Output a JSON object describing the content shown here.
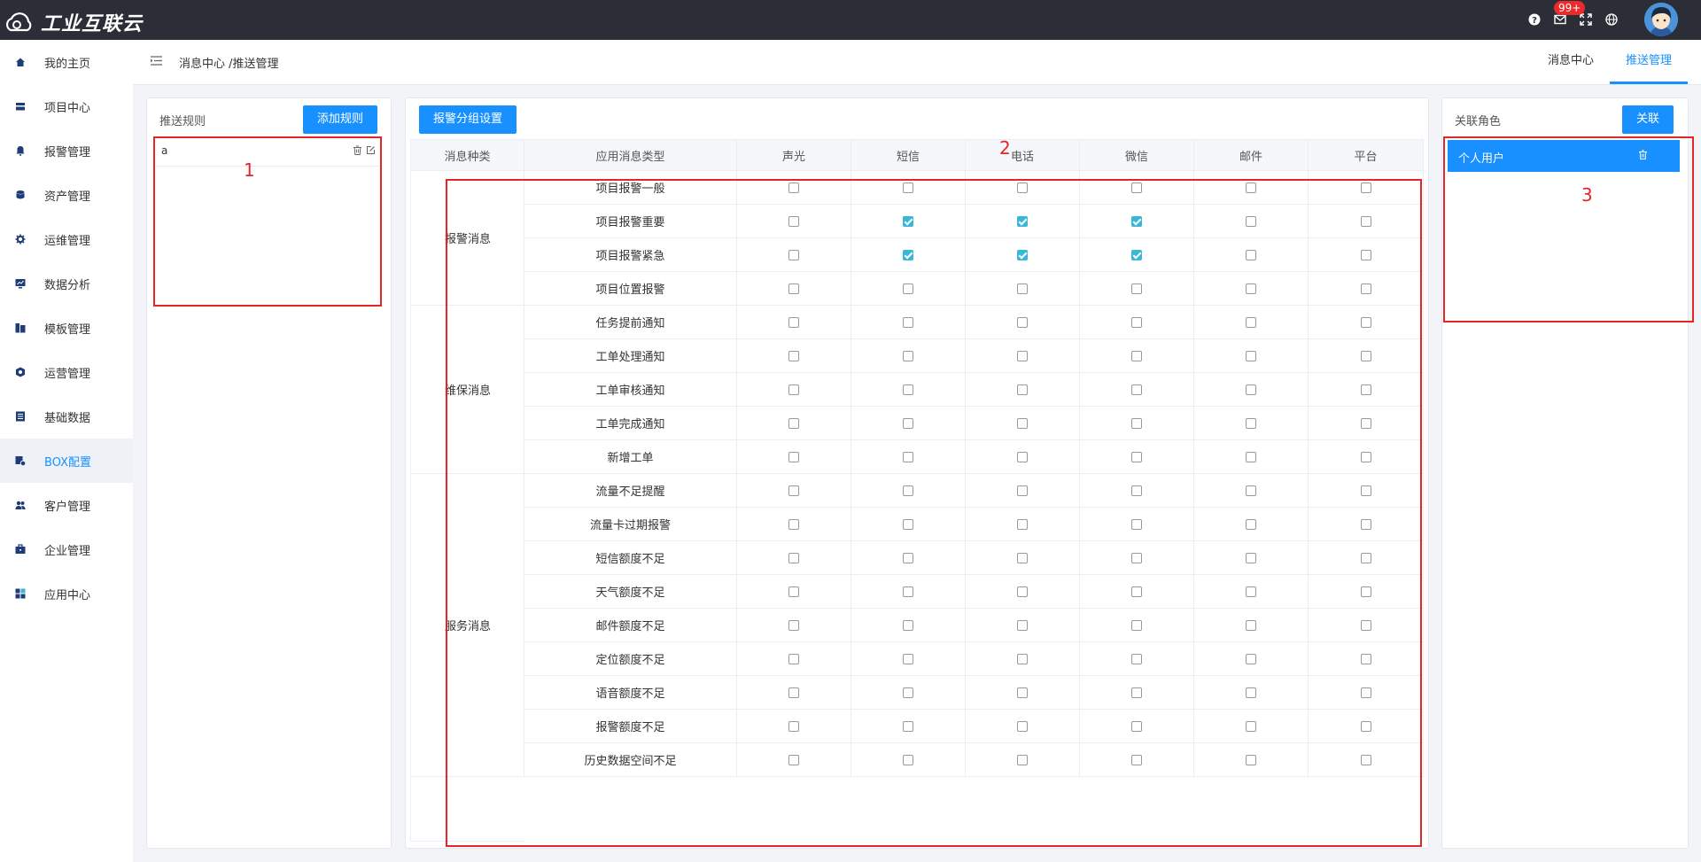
{
  "app": {
    "logo_text": "工业互联云",
    "badge": "99+"
  },
  "top_icons": [
    "help-icon",
    "mail-icon",
    "fullscreen-icon",
    "globe-icon"
  ],
  "sidebar": {
    "items": [
      {
        "label": "我的主页",
        "icon": "home-icon"
      },
      {
        "label": "项目中心",
        "icon": "project-icon"
      },
      {
        "label": "报警管理",
        "icon": "bell-icon"
      },
      {
        "label": "资产管理",
        "icon": "asset-icon"
      },
      {
        "label": "运维管理",
        "icon": "gear-icon"
      },
      {
        "label": "数据分析",
        "icon": "chart-icon"
      },
      {
        "label": "模板管理",
        "icon": "template-icon"
      },
      {
        "label": "运营管理",
        "icon": "operation-icon"
      },
      {
        "label": "基础数据",
        "icon": "database-icon"
      },
      {
        "label": "BOX配置",
        "icon": "box-config-icon",
        "active": true
      },
      {
        "label": "客户管理",
        "icon": "users-icon"
      },
      {
        "label": "企业管理",
        "icon": "briefcase-icon"
      },
      {
        "label": "应用中心",
        "icon": "apps-icon"
      }
    ]
  },
  "breadcrumb": "消息中心 /推送管理",
  "tabs": [
    {
      "label": "消息中心",
      "active": false
    },
    {
      "label": "推送管理",
      "active": true
    }
  ],
  "left_panel": {
    "title": "推送规则",
    "add_button": "添加规则",
    "rules": [
      {
        "name": "a"
      }
    ],
    "marker": "1"
  },
  "middle_panel": {
    "group_button": "报警分组设置",
    "marker": "2",
    "headers": [
      "消息种类",
      "应用消息类型",
      "声光",
      "短信",
      "电话",
      "微信",
      "邮件",
      "平台"
    ],
    "groups": [
      {
        "category": "报警消息",
        "rows": [
          {
            "type": "项目报警一般",
            "checks": [
              false,
              false,
              false,
              false,
              false,
              false
            ]
          },
          {
            "type": "项目报警重要",
            "checks": [
              false,
              true,
              true,
              true,
              false,
              false
            ]
          },
          {
            "type": "项目报警紧急",
            "checks": [
              false,
              true,
              true,
              true,
              false,
              false
            ]
          },
          {
            "type": "项目位置报警",
            "checks": [
              false,
              false,
              false,
              false,
              false,
              false
            ]
          }
        ]
      },
      {
        "category": "维保消息",
        "rows": [
          {
            "type": "任务提前通知",
            "checks": [
              false,
              false,
              false,
              false,
              false,
              false
            ]
          },
          {
            "type": "工单处理通知",
            "checks": [
              false,
              false,
              false,
              false,
              false,
              false
            ]
          },
          {
            "type": "工单审核通知",
            "checks": [
              false,
              false,
              false,
              false,
              false,
              false
            ]
          },
          {
            "type": "工单完成通知",
            "checks": [
              false,
              false,
              false,
              false,
              false,
              false
            ]
          },
          {
            "type": "新增工单",
            "checks": [
              false,
              false,
              false,
              false,
              false,
              false
            ]
          }
        ]
      },
      {
        "category": "服务消息",
        "rows": [
          {
            "type": "流量不足提醒",
            "checks": [
              false,
              false,
              false,
              false,
              false,
              false
            ]
          },
          {
            "type": "流量卡过期报警",
            "checks": [
              false,
              false,
              false,
              false,
              false,
              false
            ]
          },
          {
            "type": "短信额度不足",
            "checks": [
              false,
              false,
              false,
              false,
              false,
              false
            ]
          },
          {
            "type": "天气额度不足",
            "checks": [
              false,
              false,
              false,
              false,
              false,
              false
            ]
          },
          {
            "type": "邮件额度不足",
            "checks": [
              false,
              false,
              false,
              false,
              false,
              false
            ]
          },
          {
            "type": "定位额度不足",
            "checks": [
              false,
              false,
              false,
              false,
              false,
              false
            ]
          },
          {
            "type": "语音额度不足",
            "checks": [
              false,
              false,
              false,
              false,
              false,
              false
            ]
          },
          {
            "type": "报警额度不足",
            "checks": [
              false,
              false,
              false,
              false,
              false,
              false
            ]
          },
          {
            "type": "历史数据空间不足",
            "checks": [
              false,
              false,
              false,
              false,
              false,
              false
            ]
          }
        ]
      }
    ]
  },
  "right_panel": {
    "title": "关联角色",
    "link_button": "关联",
    "roles": [
      {
        "name": "个人用户"
      }
    ],
    "marker": "3"
  }
}
